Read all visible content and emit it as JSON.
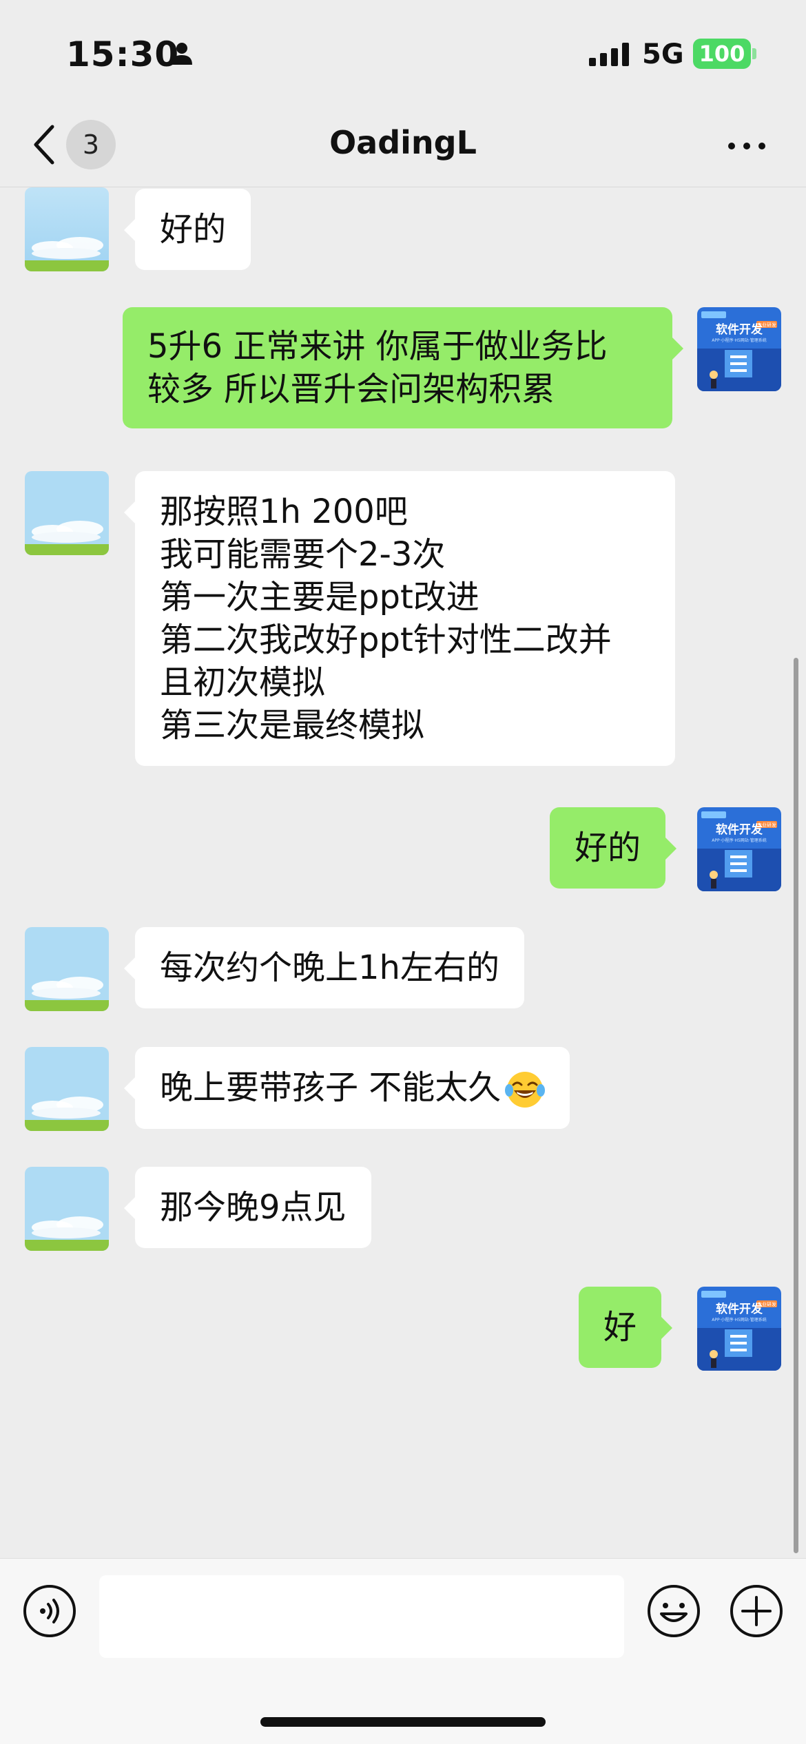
{
  "status_bar": {
    "time": "15:30",
    "network": "5G",
    "battery": "100"
  },
  "nav": {
    "unread_count": "3",
    "title": "OadingL"
  },
  "messages": [
    {
      "from": "them",
      "lines": [
        "好的"
      ]
    },
    {
      "from": "me",
      "lines": [
        "5升6 正常来讲 你属于做业务比",
        "较多 所以晋升会问架构积累"
      ]
    },
    {
      "from": "them",
      "lines": [
        "那按照1h 200吧",
        "我可能需要个2-3次",
        "第一次主要是ppt改进",
        "第二次我改好ppt针对性二改并",
        "且初次模拟",
        "第三次是最终模拟"
      ]
    },
    {
      "from": "me",
      "lines": [
        "好的"
      ]
    },
    {
      "from": "them",
      "lines": [
        "每次约个晚上1h左右的"
      ]
    },
    {
      "from": "them",
      "lines": [
        "晚上要带孩子 不能太久"
      ],
      "emoji": "laughing-tears-emoji"
    },
    {
      "from": "them",
      "lines": [
        "那今晚9点见"
      ]
    },
    {
      "from": "me",
      "lines": [
        "好"
      ]
    }
  ],
  "my_avatar": {
    "tag": "专业研发",
    "title": "软件开发",
    "subtitle": "APP·小程序·H5网站·管理系统"
  },
  "input": {
    "placeholder": ""
  },
  "colors": {
    "background": "#ededed",
    "incoming_bubble": "#ffffff",
    "outgoing_bubble": "#95ec69",
    "battery": "#4cd964"
  }
}
